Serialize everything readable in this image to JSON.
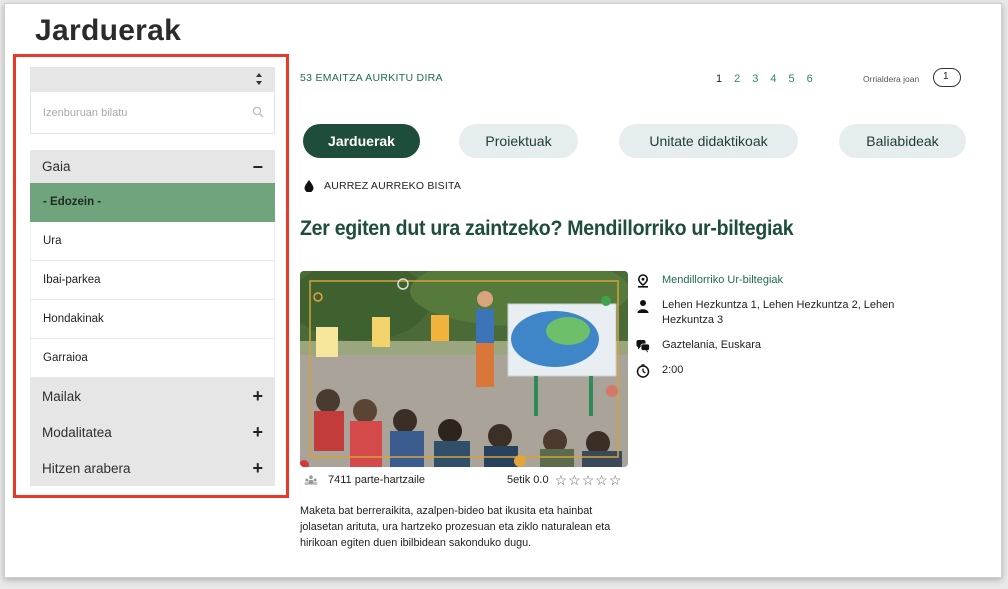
{
  "page": {
    "title": "Jarduerak"
  },
  "sidebar": {
    "sort_value": "",
    "search_placeholder": "Izenburuan bilatu",
    "sections": [
      {
        "label": "Gaia",
        "toggle": "−"
      },
      {
        "label": "Mailak",
        "toggle": "+"
      },
      {
        "label": "Modalitatea",
        "toggle": "+"
      },
      {
        "label": "Hitzen arabera",
        "toggle": "+"
      }
    ],
    "gaia_items": [
      {
        "label": "- Edozein -",
        "active": true
      },
      {
        "label": "Ura"
      },
      {
        "label": "Ibai-parkea"
      },
      {
        "label": "Hondakinak"
      },
      {
        "label": "Garraioa"
      }
    ]
  },
  "results": {
    "count_text": "53 EMAITZA AURKITU DIRA",
    "pages": [
      "1",
      "2",
      "3",
      "4",
      "5",
      "6"
    ],
    "current_page": "1",
    "goto_label": "Orrialdera joan",
    "goto_value": "1"
  },
  "tabs": [
    {
      "label": "Jarduerak",
      "active": true
    },
    {
      "label": "Proiektuak"
    },
    {
      "label": "Unitate didaktikoak"
    },
    {
      "label": "Baliabideak"
    }
  ],
  "activity": {
    "category_icon": "water-drop-icon",
    "category": "AURREZ AURREKO BISITA",
    "title": "Zer egiten dut ura zaintzeko? Mendillorriko ur-biltegiak",
    "location": "Mendillorriko Ur-biltegiak",
    "levels": "Lehen Hezkuntza 1, Lehen Hezkuntza 2, Lehen Hezkuntza 3",
    "languages": "Gaztelania, Euskara",
    "duration": "2:00",
    "participants": "7411 parte-hartzaile",
    "rating_text": "5etik 0.0",
    "rating_value": 0,
    "rating_max": 5,
    "description": "Maketa bat berreraikita, azalpen-bideo bat ikusita eta hainbat jolasetan arituta, ura hartzeko prozesuan eta ziklo naturalean eta hirikoan egiten duen ibilbidean sakonduko dugu."
  },
  "colors": {
    "accent_dark": "#1e4d3c",
    "accent_green": "#6fa47c",
    "link_green": "#1e6b52",
    "highlight_red": "#e8392b",
    "tab_bg": "#e5edef"
  }
}
